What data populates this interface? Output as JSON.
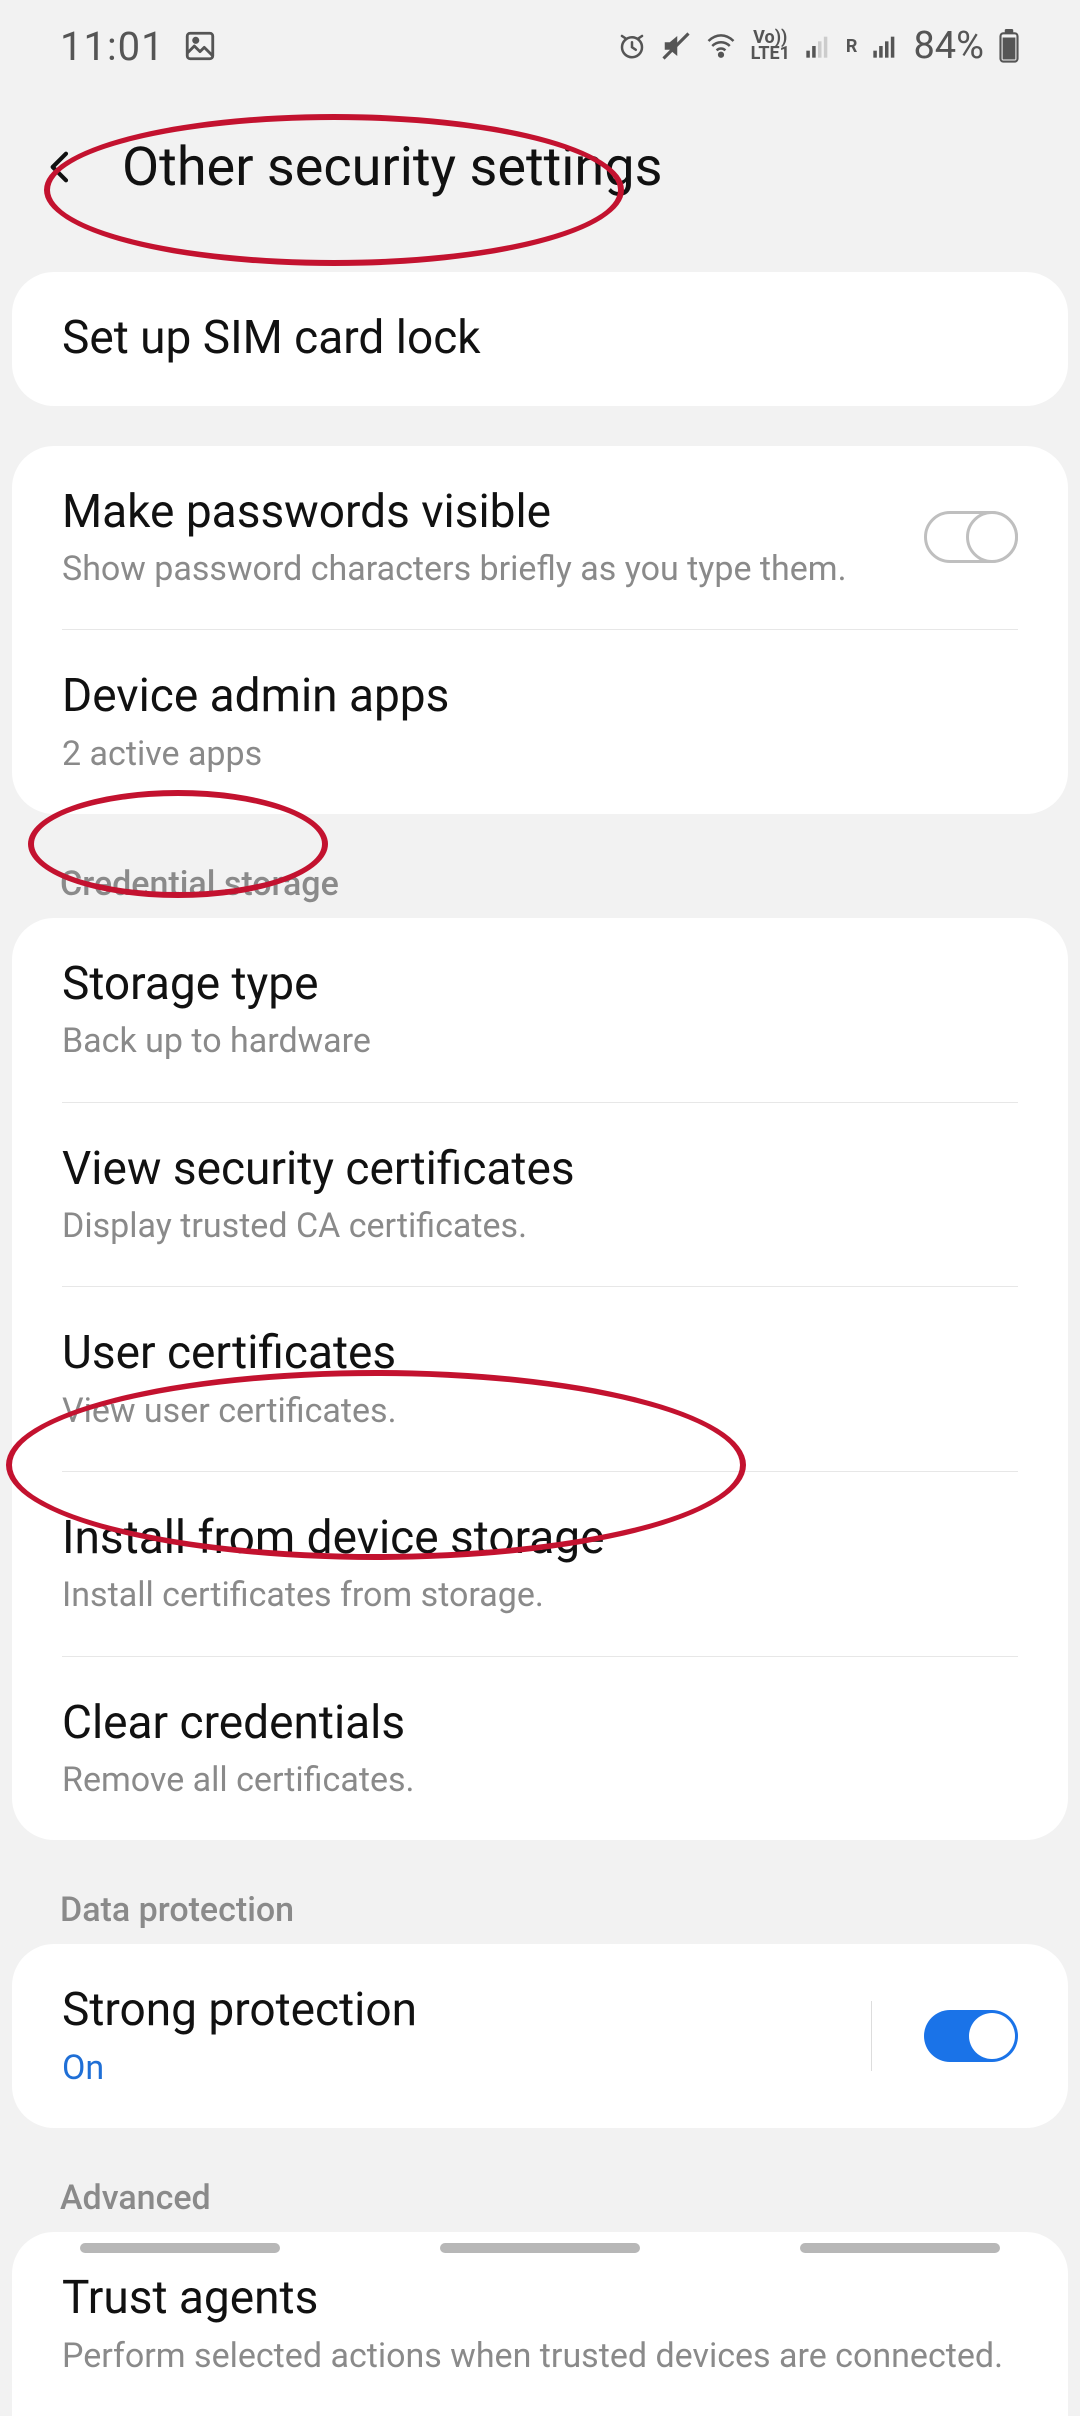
{
  "status": {
    "time": "11:01",
    "battery": "84%",
    "lte_label": "LTE1",
    "vo_label": "Vo))",
    "r_label": "R"
  },
  "header": {
    "title": "Other security settings"
  },
  "group1": {
    "sim": {
      "title": "Set up SIM card lock"
    }
  },
  "group2": {
    "pw_visible": {
      "title": "Make passwords visible",
      "sub": "Show password characters briefly as you type them."
    },
    "admin_apps": {
      "title": "Device admin apps",
      "sub": "2 active apps"
    }
  },
  "section_credential": "Credential storage",
  "group3": {
    "storage_type": {
      "title": "Storage type",
      "sub": "Back up to hardware"
    },
    "view_certs": {
      "title": "View security certificates",
      "sub": "Display trusted CA certificates."
    },
    "user_certs": {
      "title": "User certificates",
      "sub": "View user certificates."
    },
    "install": {
      "title": "Install from device storage",
      "sub": "Install certificates from storage."
    },
    "clear": {
      "title": "Clear credentials",
      "sub": "Remove all certificates."
    }
  },
  "section_data": "Data protection",
  "group4": {
    "strong": {
      "title": "Strong protection",
      "sub": "On"
    }
  },
  "section_advanced": "Advanced",
  "group5": {
    "trust": {
      "title": "Trust agents",
      "sub": "Perform selected actions when trusted devices are connected."
    }
  }
}
